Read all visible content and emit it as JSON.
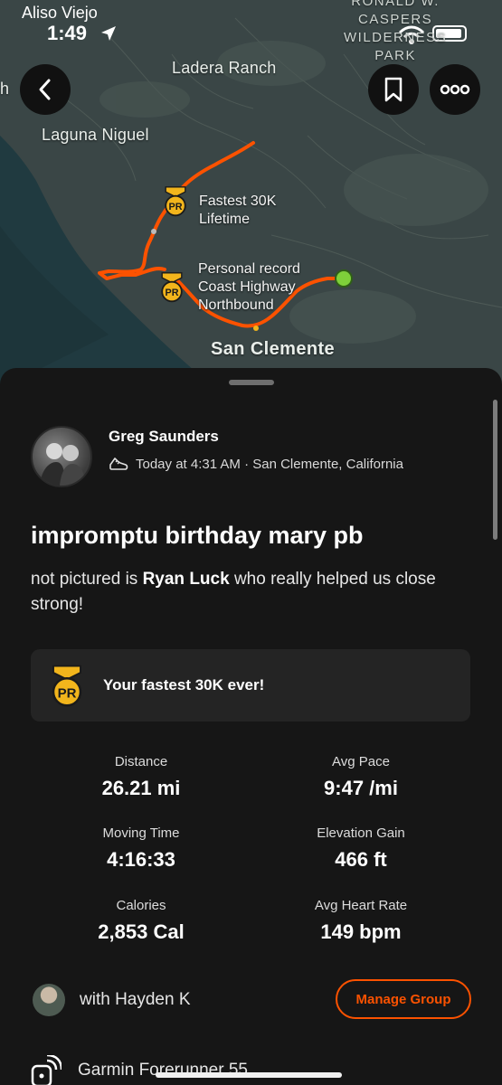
{
  "status_bar": {
    "location": "Aliso Viejo",
    "time": "1:49"
  },
  "map": {
    "labels": {
      "ladera_ranch": "Ladera Ranch",
      "laguna_niguel": "Laguna Niguel",
      "san_clemente": "San Clemente",
      "park_line1": "RONALD W.",
      "park_line2": "CASPERS",
      "park_line3": "WILDERNESS",
      "park_line4": "PARK",
      "edge_letter": "h"
    },
    "callouts": {
      "fastest_30k_line1": "Fastest 30K",
      "fastest_30k_line2": "Lifetime",
      "pr_line1": "Personal record",
      "pr_line2": "Coast Highway",
      "pr_line3": "Northbound"
    },
    "badge_text": "PR",
    "route_color": "#fc5200",
    "end_marker_color": "#7ed03a"
  },
  "activity": {
    "athlete_name": "Greg Saunders",
    "date_location": "Today at 4:31 AM · San Clemente, California",
    "title": "impromptu birthday mary pb",
    "description_prefix": "not pictured is ",
    "description_name": "Ryan Luck",
    "description_suffix": " who really helped us close strong!",
    "pr_card_text": "Your fastest 30K ever!",
    "stats": [
      {
        "label": "Distance",
        "value": "26.21 mi"
      },
      {
        "label": "Avg Pace",
        "value": "9:47 /mi"
      },
      {
        "label": "Moving Time",
        "value": "4:16:33"
      },
      {
        "label": "Elevation Gain",
        "value": "466 ft"
      },
      {
        "label": "Calories",
        "value": "2,853 Cal"
      },
      {
        "label": "Avg Heart Rate",
        "value": "149 bpm"
      }
    ],
    "group_text": "with Hayden K",
    "manage_group_label": "Manage Group",
    "device": "Garmin Forerunner 55"
  },
  "colors": {
    "accent": "#fc5200",
    "badge_gold": "#f2b51c"
  },
  "icons": [
    "back-arrow-icon",
    "bookmark-icon",
    "more-options-icon",
    "pr-medal-icon",
    "running-shoe-icon",
    "watch-icon",
    "location-arrow-icon",
    "wifi-icon",
    "battery-icon"
  ]
}
